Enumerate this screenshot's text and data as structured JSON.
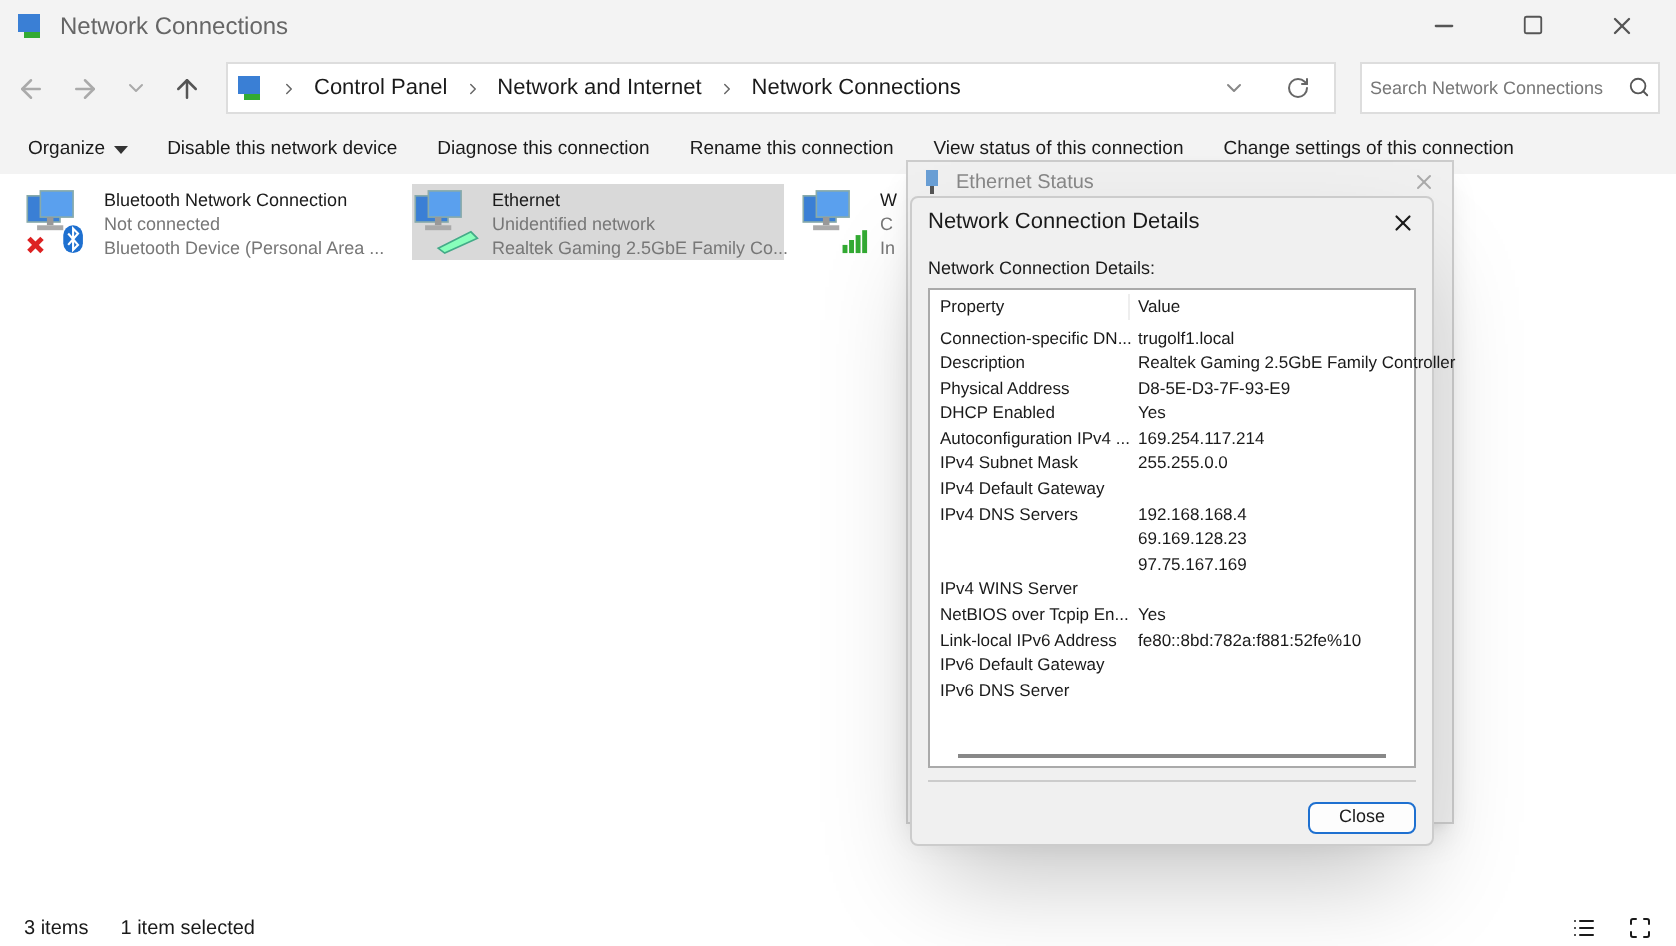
{
  "window": {
    "title": "Network Connections"
  },
  "address": {
    "crumbs": [
      "Control Panel",
      "Network and Internet",
      "Network Connections"
    ]
  },
  "search": {
    "placeholder": "Search Network Connections"
  },
  "toolbar": {
    "items": [
      {
        "label": "Organize",
        "kind": "menu"
      },
      {
        "label": "Disable this network device",
        "kind": "command"
      },
      {
        "label": "Diagnose this connection",
        "kind": "command"
      },
      {
        "label": "Rename this connection",
        "kind": "command"
      },
      {
        "label": "View status of this connection",
        "kind": "command"
      },
      {
        "label": "Change settings of this connection",
        "kind": "command"
      }
    ]
  },
  "connections": [
    {
      "name": "Bluetooth Network Connection",
      "status": "Not connected",
      "device": "Bluetooth Device (Personal Area ...",
      "kind": "bluetooth",
      "selected": false
    },
    {
      "name": "Ethernet",
      "status": "Unidentified network",
      "device": "Realtek Gaming 2.5GbE Family Co...",
      "kind": "ethernet",
      "selected": true
    },
    {
      "name": "W",
      "status": "C",
      "device": "In",
      "kind": "wifi",
      "selected": false
    }
  ],
  "status_dialog": {
    "title": "Ethernet Status"
  },
  "details_dialog": {
    "title": "Network Connection Details",
    "label": "Network Connection Details:",
    "columns": [
      "Property",
      "Value"
    ],
    "rows": [
      {
        "property": "Connection-specific DN...",
        "value": "trugolf1.local"
      },
      {
        "property": "Description",
        "value": "Realtek Gaming 2.5GbE Family Controller"
      },
      {
        "property": "Physical Address",
        "value": "D8-5E-D3-7F-93-E9"
      },
      {
        "property": "DHCP Enabled",
        "value": "Yes"
      },
      {
        "property": "Autoconfiguration IPv4 ...",
        "value": "169.254.117.214"
      },
      {
        "property": "IPv4 Subnet Mask",
        "value": "255.255.0.0"
      },
      {
        "property": "IPv4 Default Gateway"
      },
      {
        "property": "IPv4 DNS Servers",
        "value": "192.168.168.4"
      },
      {
        "value": "69.169.128.23"
      },
      {
        "value": "97.75.167.169"
      },
      {
        "property": "IPv4 WINS Server"
      },
      {
        "property": "NetBIOS over Tcpip En...",
        "value": "Yes"
      },
      {
        "property": "Link-local IPv6 Address",
        "value": "fe80::8bd:782a:f881:52fe%10"
      },
      {
        "property": "IPv6 Default Gateway"
      },
      {
        "property": "IPv6 DNS Server"
      }
    ],
    "button": "Close"
  },
  "status_bar": {
    "count": "3 items",
    "selection": "1 item selected"
  }
}
